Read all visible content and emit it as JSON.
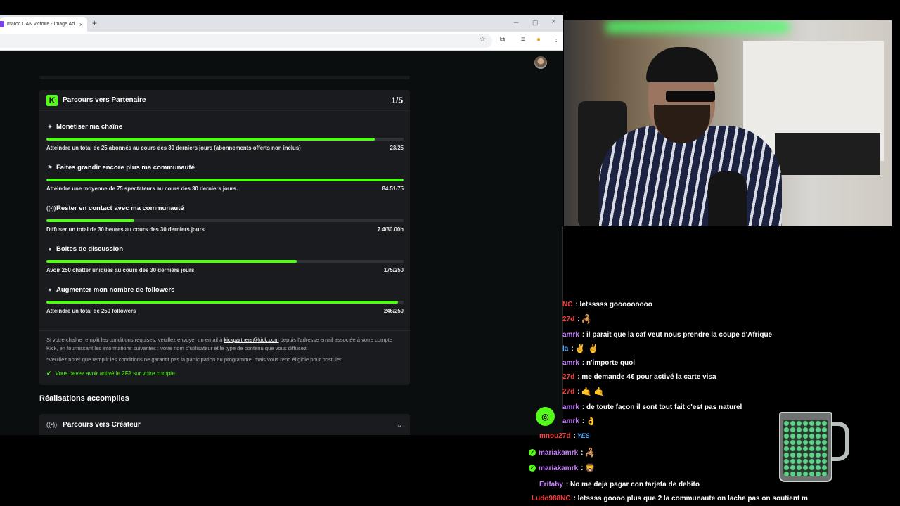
{
  "browser": {
    "tab_title": "maroc CAN victoire - Image Ad",
    "tab_close": "×",
    "new_tab": "+",
    "win_min": "─",
    "win_max": "▢",
    "win_close": "×"
  },
  "colors": {
    "kick_green": "#53fc18",
    "panel": "#191b1e",
    "background": "#0b0e0f"
  },
  "partner_card": {
    "logo_letter": "K",
    "title": "Parcours vers Partenaire",
    "step_count": "1/5",
    "goals": [
      {
        "icon": "sparkle-icon",
        "glyph": "✦",
        "title": "Monétiser ma chaîne",
        "description": "Atteindre un total de 25 abonnés au cours des 30 derniers jours (abonnements offerts non inclus)",
        "progress_text": "23/25",
        "progress_fraction": 0.92
      },
      {
        "icon": "community-icon",
        "glyph": "⚑",
        "title": "Faites grandir encore plus ma communauté",
        "description": "Atteindre une moyenne de 75 spectateurs au cours des 30 derniers jours.",
        "progress_text": "84.51/75",
        "progress_fraction": 1.0
      },
      {
        "icon": "broadcast-icon",
        "glyph": "((•))",
        "title": "Rester en contact avec ma communauté",
        "description": "Diffuser un total de 30 heures au cours des 30 derniers jours",
        "progress_text": "7.4/30.00h",
        "progress_fraction": 0.247
      },
      {
        "icon": "chat-bubble-icon",
        "glyph": "●",
        "title": "Boîtes de discussion",
        "description": "Avoir 250 chatter uniques au cours des 30 derniers jours",
        "progress_text": "175/250",
        "progress_fraction": 0.7
      },
      {
        "icon": "heart-icon",
        "glyph": "♥",
        "title": "Augmenter mon nombre de followers",
        "description": "Atteindre un total de 250 followers",
        "progress_text": "246/250",
        "progress_fraction": 0.984
      }
    ],
    "note_part1": "Si votre chaîne remplit les conditions requises, veuillez envoyer un email à ",
    "note_link": "kickpartners@kick.com",
    "note_part2": " depuis l'adresse email associée à votre compte Kick, en fournissant les informations suivantes : votre nom d'utilisateur et le type de contenu que vous diffusez.",
    "disclaimer": "*Veuillez noter que remplir les conditions ne garantit pas la participation au programme, mais vous rend éligible pour postuler.",
    "twofa_text": "Vous devez avoir activé le 2FA sur votre compte"
  },
  "achievements": {
    "section_title": "Réalisations accomplies",
    "creator_title": "Parcours vers Créateur"
  },
  "chat": {
    "messages": [
      {
        "user": "NC",
        "color": "#ff3b3b",
        "text": ": letsssss gooooooooo",
        "emote": "",
        "badge": false
      },
      {
        "user": "27d",
        "color": "#ff3b3b",
        "text": ":",
        "emote": "🦂",
        "badge": false
      },
      {
        "user": "amrk",
        "color": "#c77dff",
        "text": ": il paraît que la caf veut nous prendre la coupe d'Afrique",
        "emote": "",
        "badge": false
      },
      {
        "user": "la",
        "color": "#4aa8ff",
        "text": ":",
        "emote": "✌ ✌",
        "badge": false
      },
      {
        "user": "amrk",
        "color": "#c77dff",
        "text": ": n'importe quoi",
        "emote": "",
        "badge": false
      },
      {
        "user": "27d",
        "color": "#ff3b3b",
        "text": ": me demande 4€ pour activé la carte visa",
        "emote": "",
        "badge": false
      },
      {
        "user": "27d",
        "color": "#ff3b3b",
        "text": ":",
        "emote": "🤙 🤙",
        "badge": false
      },
      {
        "user": "amrk",
        "color": "#c77dff",
        "text": ": de toute façon il sont tout fait c'est pas naturel",
        "emote": "",
        "badge": false
      },
      {
        "user": "amrk",
        "color": "#c77dff",
        "text": ":",
        "emote": "👌",
        "badge": false
      },
      {
        "user": "mnou27d",
        "color": "#ff3b3b",
        "text": ":",
        "emote": "YES",
        "badge": false
      },
      {
        "user": "mariakamrk",
        "color": "#c77dff",
        "text": ":",
        "emote": "🦂",
        "badge": true
      },
      {
        "user": "mariakamrk",
        "color": "#c77dff",
        "text": ":",
        "emote": "🦁",
        "badge": true
      },
      {
        "user": "Erifaby",
        "color": "#c77dff",
        "text": ": No me deja pagar con tarjeta de debito",
        "emote": "",
        "badge": false
      },
      {
        "user": "Ludo988NC",
        "color": "#ff3b3b",
        "text": ": letssss goooo plus que 2 la communaute on lache pas on soutient m",
        "emote": "",
        "badge": false
      }
    ]
  }
}
